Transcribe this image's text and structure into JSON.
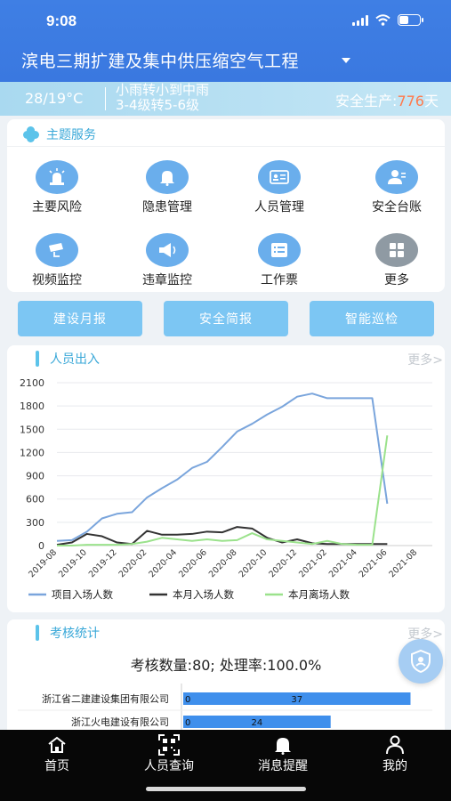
{
  "status_bar": {
    "time": "9:08"
  },
  "header": {
    "project_title": "滨电三期扩建及集中供压缩空气工程"
  },
  "weather": {
    "temperature": "28/19°C",
    "desc_line1": "小雨转小到中雨",
    "desc_line2": "3-4级转5-6级",
    "safety_label": "安全生产:",
    "safety_days": "776",
    "safety_unit": "天"
  },
  "services": {
    "title": "主题服务",
    "items": [
      {
        "label": "主要风险",
        "icon": "alarm-light-icon"
      },
      {
        "label": "隐患管理",
        "icon": "bell-icon"
      },
      {
        "label": "人员管理",
        "icon": "id-card-icon"
      },
      {
        "label": "安全台账",
        "icon": "user-ledger-icon"
      },
      {
        "label": "视频监控",
        "icon": "camera-icon"
      },
      {
        "label": "违章监控",
        "icon": "megaphone-icon"
      },
      {
        "label": "工作票",
        "icon": "ticket-icon"
      },
      {
        "label": "更多",
        "icon": "grid-icon"
      }
    ]
  },
  "buttons": [
    "建设月报",
    "安全简报",
    "智能巡检"
  ],
  "personnel": {
    "title": "人员出入",
    "more": "更多>"
  },
  "colors": {
    "line_project": "#7aa5dc",
    "line_in": "#333333",
    "line_out": "#9be28c",
    "accent": "#5cc3ea",
    "bar": "#3f8fec"
  },
  "chart_data": {
    "type": "line",
    "x": [
      "2019-08",
      "2019-09",
      "2019-10",
      "2019-11",
      "2019-12",
      "2020-01",
      "2020-02",
      "2020-03",
      "2020-04",
      "2020-05",
      "2020-06",
      "2020-07",
      "2020-08",
      "2020-09",
      "2020-10",
      "2020-11",
      "2020-12",
      "2021-01",
      "2021-02",
      "2021-03",
      "2021-04",
      "2021-05",
      "2021-06",
      "2021-07",
      "2021-08",
      "2021-09"
    ],
    "x_tick_labels": [
      "2019-08",
      "2019-10",
      "2019-12",
      "2020-02",
      "2020-04",
      "2020-06",
      "2020-08",
      "2020-10",
      "2020-12",
      "2021-02",
      "2021-04",
      "2021-06",
      "2021-08"
    ],
    "y_ticks": [
      0,
      300,
      600,
      900,
      1200,
      1500,
      1800,
      2100
    ],
    "ylim": [
      0,
      2100
    ],
    "legend_position": "bottom",
    "series": [
      {
        "name": "项目入场人数",
        "values": [
          60,
          70,
          180,
          350,
          410,
          430,
          620,
          740,
          850,
          1000,
          1080,
          1270,
          1470,
          1570,
          1690,
          1790,
          1920,
          1960,
          1900,
          1900,
          1900,
          1900,
          540
        ]
      },
      {
        "name": "本月入场人数",
        "values": [
          10,
          40,
          150,
          120,
          40,
          20,
          190,
          140,
          140,
          150,
          180,
          170,
          240,
          220,
          100,
          40,
          80,
          30,
          20,
          20,
          20,
          20,
          20
        ]
      },
      {
        "name": "本月离场人数",
        "values": [
          0,
          0,
          10,
          10,
          10,
          20,
          50,
          100,
          80,
          60,
          80,
          60,
          70,
          160,
          80,
          60,
          40,
          20,
          60,
          20,
          10,
          10,
          1420
        ]
      }
    ]
  },
  "assessment": {
    "title": "考核统计",
    "more": "更多>",
    "summary": "考核数量:80; 处理率:100.0%",
    "rows": [
      {
        "company": "浙江省二建建设集团有限公司",
        "zero": "0",
        "value": 37
      },
      {
        "company": "浙江火电建设有限公司",
        "zero": "0",
        "value": 24
      }
    ]
  },
  "tabbar": [
    "首页",
    "人员查询",
    "消息提醒",
    "我的"
  ]
}
